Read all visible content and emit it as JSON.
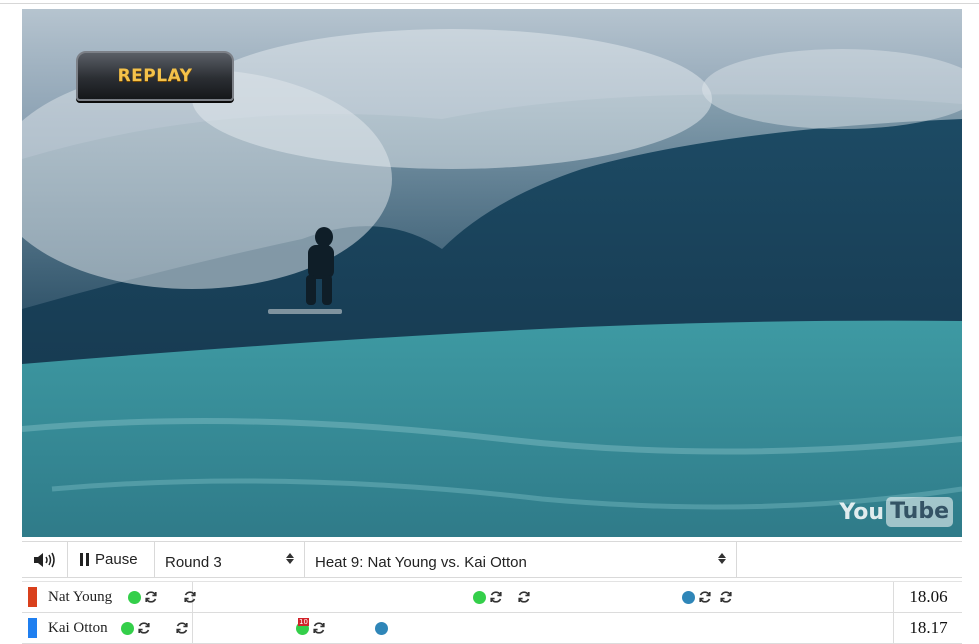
{
  "video": {
    "overlay_badge": "REPLAY",
    "watermark_you": "You",
    "watermark_tube": "Tube"
  },
  "controls": {
    "volume_icon": "speaker-icon",
    "pause_label": "Pause",
    "round_select": {
      "selected": "Round 3"
    },
    "heat_select": {
      "selected": "Heat 9: Nat Young vs. Kai Otton"
    }
  },
  "surfers": [
    {
      "name": "Nat Young",
      "color": "#d9401c",
      "score": "18.06",
      "waves": [
        {
          "kind": "scored",
          "offset": 0.113
        },
        {
          "kind": "wave",
          "offset": 0.13
        },
        {
          "kind": "wave",
          "offset": 0.171
        },
        {
          "kind": "scored",
          "offset": 0.48
        },
        {
          "kind": "wave",
          "offset": 0.497
        },
        {
          "kind": "wave",
          "offset": 0.527
        },
        {
          "kind": "priority",
          "offset": 0.702
        },
        {
          "kind": "wave",
          "offset": 0.719
        },
        {
          "kind": "wave",
          "offset": 0.742
        }
      ]
    },
    {
      "name": "Kai Otton",
      "color": "#1f7ff0",
      "score": "18.17",
      "waves": [
        {
          "kind": "scored",
          "offset": 0.105
        },
        {
          "kind": "wave",
          "offset": 0.122
        },
        {
          "kind": "wave",
          "offset": 0.163
        },
        {
          "kind": "scored",
          "offset": 0.291,
          "label": "10"
        },
        {
          "kind": "wave",
          "offset": 0.308
        },
        {
          "kind": "priority",
          "offset": 0.375
        }
      ]
    }
  ]
}
